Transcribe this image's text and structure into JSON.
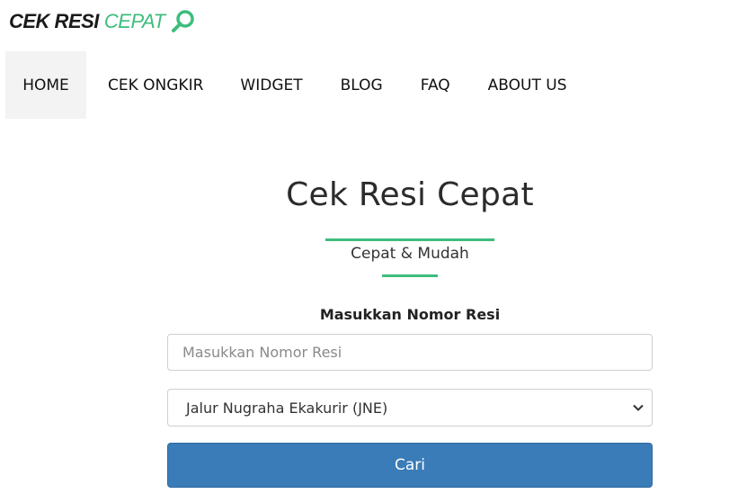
{
  "logo": {
    "part1": "CEK RESI",
    "part2": "CEPAT",
    "icon": "magnifier-icon"
  },
  "nav": {
    "items": [
      {
        "label": "HOME",
        "active": true
      },
      {
        "label": "CEK ONGKIR",
        "active": false
      },
      {
        "label": "WIDGET",
        "active": false
      },
      {
        "label": "BLOG",
        "active": false
      },
      {
        "label": "FAQ",
        "active": false
      },
      {
        "label": "ABOUT US",
        "active": false
      }
    ]
  },
  "hero": {
    "title": "Cek Resi Cepat",
    "subtitle": "Cepat & Mudah"
  },
  "form": {
    "label": "Masukkan Nomor Resi",
    "input_value": "",
    "input_placeholder": "Masukkan Nomor Resi",
    "courier_selected": "Jalur Nugraha Ekakurir (JNE)",
    "submit_label": "Cari"
  },
  "colors": {
    "accent_green": "#3ebd7c",
    "button_blue": "#3a7cb8"
  }
}
